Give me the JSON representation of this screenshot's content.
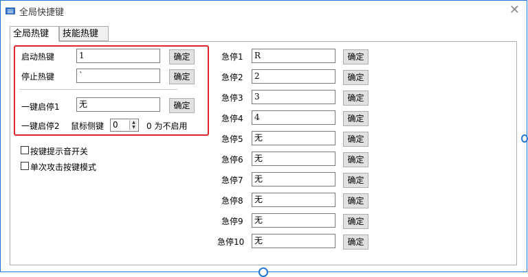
{
  "window": {
    "title": "全局快捷键",
    "close_glyph": "✕"
  },
  "tabs": [
    {
      "label": "全局热键",
      "active": true
    },
    {
      "label": "技能热键",
      "active": false
    }
  ],
  "left": {
    "start_hotkey": {
      "label": "启动热键",
      "value": "1",
      "button": "确定"
    },
    "stop_hotkey": {
      "label": "停止热键",
      "value": "`",
      "button": "确定"
    },
    "one_key_1": {
      "label": "一键启停1",
      "value": "无",
      "button": "确定"
    },
    "one_key_2": {
      "label": "一键启停2",
      "mouse_label": "鼠标侧键",
      "spin_value": "0",
      "hint": "0 为不启用"
    },
    "checkboxes": [
      {
        "label": "按键提示音开关",
        "checked": false
      },
      {
        "label": "单次攻击按键模式",
        "checked": false
      }
    ]
  },
  "emergency": [
    {
      "label": "急停1",
      "value": "R",
      "button": "确定"
    },
    {
      "label": "急停2",
      "value": "2",
      "button": "确定"
    },
    {
      "label": "急停3",
      "value": "3",
      "button": "确定"
    },
    {
      "label": "急停4",
      "value": "4",
      "button": "确定"
    },
    {
      "label": "急停5",
      "value": "无",
      "button": "确定"
    },
    {
      "label": "急停6",
      "value": "无",
      "button": "确定"
    },
    {
      "label": "急停7",
      "value": "无",
      "button": "确定"
    },
    {
      "label": "急停8",
      "value": "无",
      "button": "确定"
    },
    {
      "label": "急停9",
      "value": "无",
      "button": "确定"
    },
    {
      "label": "急停10",
      "value": "无",
      "button": "确定"
    }
  ],
  "colors": {
    "highlight_border": "#e0252b",
    "window_border": "#1e74d3"
  }
}
